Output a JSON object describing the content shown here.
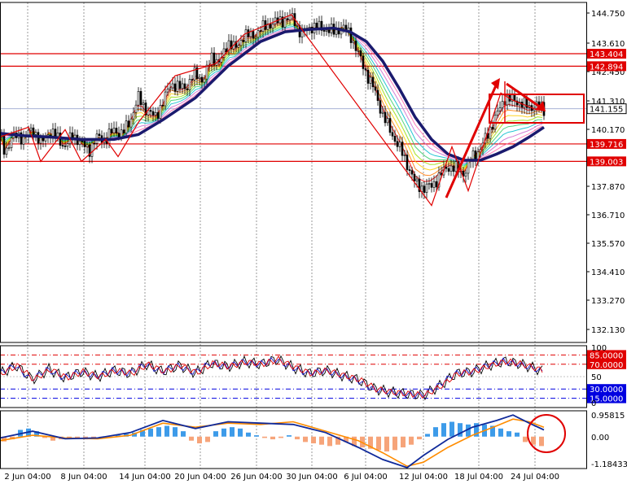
{
  "chart_data": [
    {
      "type": "line",
      "panel": "price",
      "title": "",
      "xlabel": "",
      "ylabel": "",
      "x": [
        "2 Jun 04:00",
        "8 Jun 04:00",
        "14 Jun 04:00",
        "20 Jun 04:00",
        "26 Jun 04:00",
        "30 Jun 04:00",
        "6 Jul 04:00",
        "12 Jul 04:00",
        "18 Jul 04:00",
        "24 Jul 04:00"
      ],
      "ylim": [
        131.6,
        145.5
      ],
      "y_ticks": [
        "144.750",
        "143.610",
        "142.450",
        "141.310",
        "140.170",
        "137.870",
        "136.710",
        "135.570",
        "134.410",
        "133.270",
        "132.130"
      ],
      "price_path": [
        [
          0,
          140.0
        ],
        [
          6,
          139.4
        ],
        [
          14,
          139.9
        ],
        [
          22,
          140.1
        ],
        [
          30,
          139.9
        ],
        [
          40,
          140.4
        ],
        [
          50,
          139.7
        ],
        [
          60,
          140.2
        ],
        [
          70,
          140.0
        ],
        [
          80,
          139.6
        ],
        [
          90,
          140.1
        ],
        [
          100,
          139.7
        ],
        [
          110,
          139.5
        ],
        [
          120,
          140.0
        ],
        [
          130,
          139.9
        ],
        [
          140,
          140.3
        ],
        [
          150,
          140.1
        ],
        [
          160,
          140.7
        ],
        [
          170,
          141.6
        ],
        [
          180,
          141.1
        ],
        [
          190,
          140.8
        ],
        [
          200,
          141.4
        ],
        [
          210,
          142.2
        ],
        [
          220,
          142.0
        ],
        [
          230,
          142.1
        ],
        [
          240,
          142.6
        ],
        [
          250,
          142.3
        ],
        [
          260,
          143.3
        ],
        [
          270,
          143.0
        ],
        [
          280,
          143.9
        ],
        [
          290,
          143.6
        ],
        [
          300,
          144.2
        ],
        [
          310,
          144.1
        ],
        [
          320,
          144.4
        ],
        [
          330,
          144.6
        ],
        [
          340,
          144.7
        ],
        [
          350,
          144.8
        ],
        [
          360,
          144.9
        ],
        [
          365,
          144.5
        ],
        [
          370,
          144.2
        ],
        [
          380,
          144.5
        ],
        [
          390,
          144.5
        ],
        [
          400,
          144.4
        ],
        [
          410,
          144.3
        ],
        [
          420,
          144.5
        ],
        [
          430,
          144.2
        ],
        [
          440,
          143.4
        ],
        [
          450,
          142.6
        ],
        [
          460,
          141.9
        ],
        [
          470,
          140.9
        ],
        [
          480,
          140.2
        ],
        [
          490,
          139.6
        ],
        [
          500,
          138.9
        ],
        [
          510,
          138.1
        ],
        [
          520,
          137.9
        ],
        [
          530,
          138.0
        ],
        [
          540,
          138.4
        ],
        [
          550,
          138.8
        ],
        [
          560,
          138.7
        ],
        [
          570,
          138.5
        ],
        [
          580,
          139.2
        ],
        [
          590,
          139.5
        ],
        [
          600,
          140.2
        ],
        [
          610,
          140.9
        ],
        [
          620,
          141.6
        ],
        [
          630,
          141.5
        ],
        [
          640,
          141.4
        ],
        [
          650,
          141.2
        ],
        [
          660,
          141.3
        ],
        [
          668,
          141.1
        ]
      ],
      "ema_path": [
        [
          0,
          140.15
        ],
        [
          30,
          140.05
        ],
        [
          60,
          140.0
        ],
        [
          100,
          139.9
        ],
        [
          140,
          139.9
        ],
        [
          170,
          140.1
        ],
        [
          200,
          140.7
        ],
        [
          240,
          141.6
        ],
        [
          280,
          142.9
        ],
        [
          320,
          143.9
        ],
        [
          350,
          144.3
        ],
        [
          380,
          144.4
        ],
        [
          410,
          144.45
        ],
        [
          430,
          144.3
        ],
        [
          450,
          143.9
        ],
        [
          470,
          143.1
        ],
        [
          490,
          142.0
        ],
        [
          510,
          140.8
        ],
        [
          530,
          139.9
        ],
        [
          550,
          139.3
        ],
        [
          570,
          139.05
        ],
        [
          590,
          139.05
        ],
        [
          610,
          139.3
        ],
        [
          630,
          139.6
        ],
        [
          650,
          140.0
        ],
        [
          668,
          140.4
        ]
      ],
      "fan_colors": [
        "#ff0000",
        "#ff7700",
        "#ffcc00",
        "#99dd00",
        "#33cc66",
        "#00bbcc",
        "#cc66cc",
        "#ff66aa"
      ],
      "levels": [
        {
          "value": 143.404,
          "label": "143.404",
          "color": "#e00000",
          "highlight": true
        },
        {
          "value": 142.894,
          "label": "142.894",
          "color": "#e00000",
          "highlight": true
        },
        {
          "value": 141.155,
          "label": "141.155",
          "color": "#aab2d6",
          "highlight": false
        },
        {
          "value": 139.716,
          "label": "139.716",
          "color": "#e00000",
          "highlight": true
        },
        {
          "value": 139.003,
          "label": "139.003",
          "color": "#e00000",
          "highlight": true
        }
      ],
      "current_price": "141.155",
      "annotations": {
        "zigzag_color": "#e00000",
        "box_color": "#e00000",
        "arrow_color": "#e00000"
      }
    },
    {
      "type": "line",
      "panel": "oscillator",
      "ylim": [
        0,
        100
      ],
      "y_ticks": [
        "100",
        "50",
        "0"
      ],
      "levels": [
        {
          "value": 85,
          "label": "85.0000",
          "color": "#e00000"
        },
        {
          "value": 70,
          "label": "70.0000",
          "color": "#e00000"
        },
        {
          "value": 30,
          "label": "30.0000",
          "color": "#0000e0"
        },
        {
          "value": 15,
          "label": "15.0000",
          "color": "#0000e0"
        }
      ],
      "osc_path": [
        [
          0,
          55
        ],
        [
          20,
          68
        ],
        [
          40,
          45
        ],
        [
          60,
          62
        ],
        [
          80,
          48
        ],
        [
          100,
          58
        ],
        [
          120,
          50
        ],
        [
          140,
          60
        ],
        [
          160,
          55
        ],
        [
          180,
          70
        ],
        [
          200,
          58
        ],
        [
          220,
          68
        ],
        [
          240,
          56
        ],
        [
          260,
          72
        ],
        [
          280,
          66
        ],
        [
          300,
          74
        ],
        [
          320,
          70
        ],
        [
          340,
          78
        ],
        [
          360,
          65
        ],
        [
          380,
          55
        ],
        [
          400,
          60
        ],
        [
          420,
          52
        ],
        [
          440,
          45
        ],
        [
          460,
          30
        ],
        [
          480,
          25
        ],
        [
          500,
          22
        ],
        [
          520,
          20
        ],
        [
          540,
          35
        ],
        [
          560,
          55
        ],
        [
          580,
          58
        ],
        [
          600,
          68
        ],
        [
          620,
          75
        ],
        [
          640,
          70
        ],
        [
          660,
          62
        ],
        [
          668,
          58
        ]
      ]
    },
    {
      "type": "bar",
      "panel": "macd",
      "ylim": [
        -1.18433,
        0.95815
      ],
      "y_ticks": [
        "0.95815",
        "0.00",
        "-1.18433"
      ],
      "hist": [
        [
          5,
          -0.18
        ],
        [
          15,
          -0.1
        ],
        [
          25,
          0.25
        ],
        [
          35,
          0.3
        ],
        [
          45,
          0.2
        ],
        [
          55,
          -0.05
        ],
        [
          65,
          -0.15
        ],
        [
          75,
          -0.1
        ],
        [
          85,
          -0.05
        ],
        [
          95,
          -0.05
        ],
        [
          105,
          -0.1
        ],
        [
          115,
          -0.08
        ],
        [
          125,
          -0.05
        ],
        [
          135,
          -0.02
        ],
        [
          145,
          0.05
        ],
        [
          155,
          0.1
        ],
        [
          165,
          0.15
        ],
        [
          175,
          0.25
        ],
        [
          185,
          0.3
        ],
        [
          195,
          0.35
        ],
        [
          205,
          0.4
        ],
        [
          215,
          0.35
        ],
        [
          225,
          0.2
        ],
        [
          235,
          -0.15
        ],
        [
          245,
          -0.25
        ],
        [
          255,
          -0.2
        ],
        [
          265,
          0.2
        ],
        [
          275,
          0.3
        ],
        [
          285,
          0.35
        ],
        [
          295,
          0.3
        ],
        [
          305,
          0.15
        ],
        [
          315,
          0.05
        ],
        [
          325,
          -0.05
        ],
        [
          335,
          -0.1
        ],
        [
          345,
          -0.05
        ],
        [
          355,
          0.05
        ],
        [
          365,
          -0.1
        ],
        [
          375,
          -0.2
        ],
        [
          385,
          -0.25
        ],
        [
          395,
          -0.3
        ],
        [
          405,
          -0.35
        ],
        [
          415,
          -0.3
        ],
        [
          425,
          -0.2
        ],
        [
          435,
          -0.35
        ],
        [
          445,
          -0.4
        ],
        [
          455,
          -0.45
        ],
        [
          465,
          -0.5
        ],
        [
          475,
          -0.55
        ],
        [
          485,
          -0.5
        ],
        [
          495,
          -0.4
        ],
        [
          505,
          -0.3
        ],
        [
          515,
          -0.1
        ],
        [
          525,
          0.1
        ],
        [
          535,
          0.35
        ],
        [
          545,
          0.5
        ],
        [
          555,
          0.55
        ],
        [
          565,
          0.5
        ],
        [
          575,
          0.45
        ],
        [
          585,
          0.5
        ],
        [
          595,
          0.45
        ],
        [
          605,
          0.4
        ],
        [
          615,
          0.3
        ],
        [
          625,
          0.2
        ],
        [
          635,
          0.15
        ],
        [
          645,
          -0.2
        ],
        [
          655,
          -0.3
        ],
        [
          665,
          -0.35
        ]
      ],
      "signal_path": [
        [
          0,
          -0.15
        ],
        [
          40,
          0.05
        ],
        [
          80,
          -0.05
        ],
        [
          120,
          -0.08
        ],
        [
          160,
          0.05
        ],
        [
          200,
          0.5
        ],
        [
          240,
          0.35
        ],
        [
          280,
          0.5
        ],
        [
          320,
          0.45
        ],
        [
          360,
          0.55
        ],
        [
          400,
          0.2
        ],
        [
          440,
          -0.15
        ],
        [
          470,
          -0.6
        ],
        [
          500,
          -1.1
        ],
        [
          520,
          -0.95
        ],
        [
          550,
          -0.4
        ],
        [
          580,
          0.05
        ],
        [
          610,
          0.4
        ],
        [
          630,
          0.65
        ],
        [
          650,
          0.55
        ],
        [
          668,
          0.35
        ]
      ],
      "macd_path": [
        [
          0,
          -0.05
        ],
        [
          40,
          0.2
        ],
        [
          80,
          -0.08
        ],
        [
          120,
          -0.05
        ],
        [
          160,
          0.15
        ],
        [
          200,
          0.6
        ],
        [
          240,
          0.3
        ],
        [
          280,
          0.55
        ],
        [
          320,
          0.5
        ],
        [
          360,
          0.45
        ],
        [
          400,
          0.15
        ],
        [
          440,
          -0.4
        ],
        [
          470,
          -0.85
        ],
        [
          500,
          -1.15
        ],
        [
          520,
          -0.7
        ],
        [
          550,
          -0.1
        ],
        [
          580,
          0.35
        ],
        [
          610,
          0.6
        ],
        [
          630,
          0.8
        ],
        [
          650,
          0.5
        ],
        [
          668,
          0.25
        ]
      ]
    }
  ]
}
